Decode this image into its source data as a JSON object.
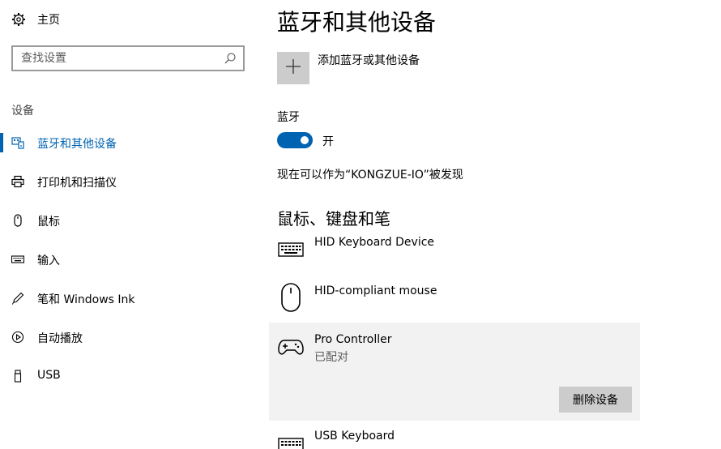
{
  "sidebar": {
    "home_label": "主页",
    "search_placeholder": "查找设置",
    "section_title": "设备",
    "items": [
      {
        "label": "蓝牙和其他设备",
        "icon": "bluetooth-devices-icon",
        "active": true
      },
      {
        "label": "打印机和扫描仪",
        "icon": "printer-icon",
        "active": false
      },
      {
        "label": "鼠标",
        "icon": "mouse-icon",
        "active": false
      },
      {
        "label": "输入",
        "icon": "keyboard-icon",
        "active": false
      },
      {
        "label": "笔和 Windows Ink",
        "icon": "pen-icon",
        "active": false
      },
      {
        "label": "自动播放",
        "icon": "autoplay-icon",
        "active": false
      },
      {
        "label": "USB",
        "icon": "usb-icon",
        "active": false
      }
    ]
  },
  "main": {
    "title": "蓝牙和其他设备",
    "add_label": "添加蓝牙或其他设备",
    "bluetooth_label": "蓝牙",
    "toggle_state": "开",
    "discoverable_text": "现在可以作为“KONGZUE-IO”被发现",
    "section_title": "鼠标、键盘和笔",
    "devices": [
      {
        "name": "HID Keyboard Device",
        "icon": "keyboard-icon"
      },
      {
        "name": "HID-compliant mouse",
        "icon": "mouse-icon"
      },
      {
        "name": "Pro Controller",
        "status": "已配对",
        "icon": "gamepad-icon",
        "action": "删除设备"
      },
      {
        "name": "USB Keyboard",
        "icon": "keyboard-icon"
      }
    ]
  },
  "colors": {
    "accent": "#0063b1",
    "selected_bg": "#f2f2f2",
    "button_bg": "#cccccc"
  }
}
